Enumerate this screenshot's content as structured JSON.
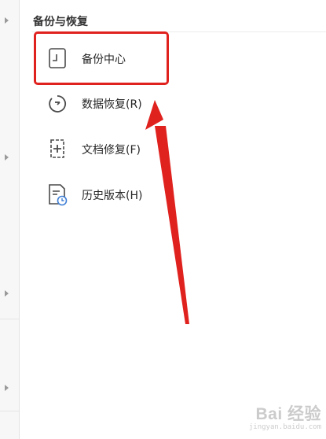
{
  "section": {
    "title": "备份与恢复"
  },
  "menu": {
    "items": [
      {
        "label": "备份中心",
        "icon": "backup-center-icon"
      },
      {
        "label": "数据恢复(R)",
        "icon": "data-recovery-icon"
      },
      {
        "label": "文档修复(F)",
        "icon": "document-repair-icon"
      },
      {
        "label": "历史版本(H)",
        "icon": "version-history-icon"
      }
    ]
  },
  "annotation": {
    "highlight_color": "#e0221f",
    "arrow_color": "#e0221f",
    "target": "备份中心"
  },
  "watermark": {
    "logo": "Bai 经验",
    "url": "jingyan.baidu.com"
  }
}
